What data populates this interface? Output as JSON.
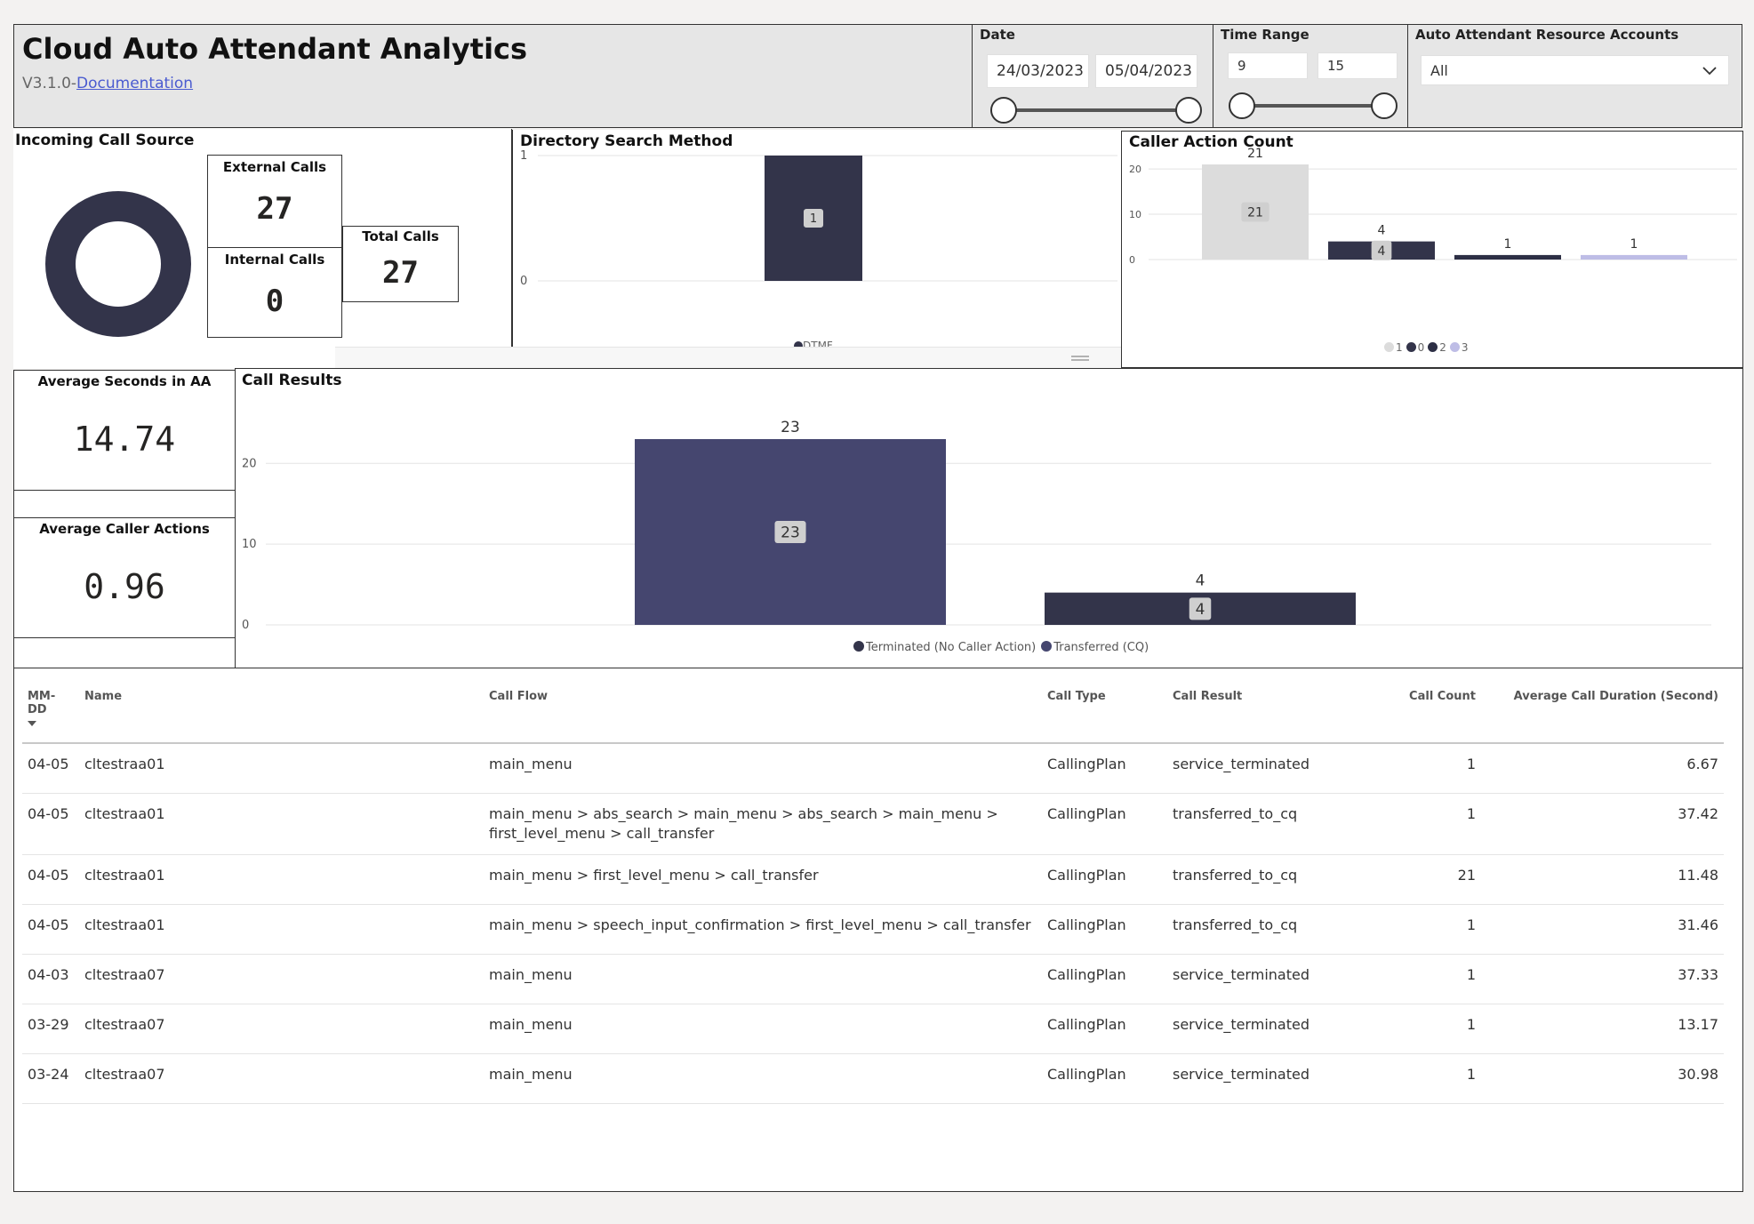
{
  "header": {
    "title": "Cloud Auto Attendant Analytics",
    "version": "V3.1.0-",
    "doc_link": "Documentation"
  },
  "filters": {
    "date": {
      "label": "Date",
      "start": "24/03/2023",
      "end": "05/04/2023"
    },
    "time_range": {
      "label": "Time Range",
      "start": "9",
      "end": "15"
    },
    "resource_accounts": {
      "label": "Auto Attendant Resource Accounts",
      "value": "All"
    }
  },
  "incoming_call_source": {
    "title": "Incoming Call Source",
    "external_label": "External Calls",
    "external_value": "27",
    "internal_label": "Internal Calls",
    "internal_value": "0",
    "total_label": "Total Calls",
    "total_value": "27",
    "donut_color": "#33344a"
  },
  "kpis": {
    "avg_seconds_label": "Average Seconds in AA",
    "avg_seconds_value": "14.74",
    "avg_actions_label": "Average Caller Actions",
    "avg_actions_value": "0.96"
  },
  "chart_data": [
    {
      "id": "directory-search-method",
      "type": "bar",
      "title": "Directory Search Method",
      "categories": [
        ""
      ],
      "values": [
        1
      ],
      "data_labels": [
        "1"
      ],
      "yticks": [
        "0",
        "1"
      ],
      "ylim": [
        0,
        1
      ],
      "legend_partial": "DTMF",
      "colors": [
        "#33344a"
      ]
    },
    {
      "id": "caller-action-count",
      "type": "bar",
      "title": "Caller Action Count",
      "categories": [
        "1",
        "0",
        "2",
        "3"
      ],
      "values": [
        21,
        4,
        1,
        1
      ],
      "data_labels": [
        "21",
        "4",
        "1",
        "1"
      ],
      "inner_labels": [
        "21",
        "4",
        "",
        ""
      ],
      "yticks": [
        "0",
        "10",
        "20"
      ],
      "ylim": [
        0,
        21
      ],
      "legend": [
        "1",
        "0",
        "2",
        "3"
      ],
      "colors": [
        "#dcdcdc",
        "#33344a",
        "#2d2f45",
        "#bebde6"
      ]
    },
    {
      "id": "call-results",
      "type": "bar",
      "title": "Call Results",
      "categories": [
        "Transferred (CQ)",
        "Terminated (No Caller Action)"
      ],
      "values": [
        23,
        4
      ],
      "data_labels": [
        "23",
        "4"
      ],
      "yticks": [
        "0",
        "10",
        "20"
      ],
      "ylim": [
        0,
        23
      ],
      "legend": [
        "Terminated (No Caller Action)",
        "Transferred (CQ)"
      ],
      "legend_colors": [
        "#33344a",
        "#45466f"
      ],
      "colors": [
        "#45466f",
        "#33344a"
      ]
    }
  ],
  "table": {
    "columns": [
      "MM-DD",
      "Name",
      "Call Flow",
      "Call Type",
      "Call Result",
      "Call Count",
      "Average Call Duration (Second)"
    ],
    "rows": [
      [
        "04-05",
        "cltestraa01",
        "main_menu",
        "CallingPlan",
        "service_terminated",
        "1",
        "6.67"
      ],
      [
        "04-05",
        "cltestraa01",
        "main_menu > abs_search > main_menu > abs_search > main_menu > first_level_menu > call_transfer",
        "CallingPlan",
        "transferred_to_cq",
        "1",
        "37.42"
      ],
      [
        "04-05",
        "cltestraa01",
        "main_menu > first_level_menu > call_transfer",
        "CallingPlan",
        "transferred_to_cq",
        "21",
        "11.48"
      ],
      [
        "04-05",
        "cltestraa01",
        "main_menu > speech_input_confirmation > first_level_menu > call_transfer",
        "CallingPlan",
        "transferred_to_cq",
        "1",
        "31.46"
      ],
      [
        "04-03",
        "cltestraa07",
        "main_menu",
        "CallingPlan",
        "service_terminated",
        "1",
        "37.33"
      ],
      [
        "03-29",
        "cltestraa07",
        "main_menu",
        "CallingPlan",
        "service_terminated",
        "1",
        "13.17"
      ],
      [
        "03-24",
        "cltestraa07",
        "main_menu",
        "CallingPlan",
        "service_terminated",
        "1",
        "30.98"
      ]
    ]
  }
}
